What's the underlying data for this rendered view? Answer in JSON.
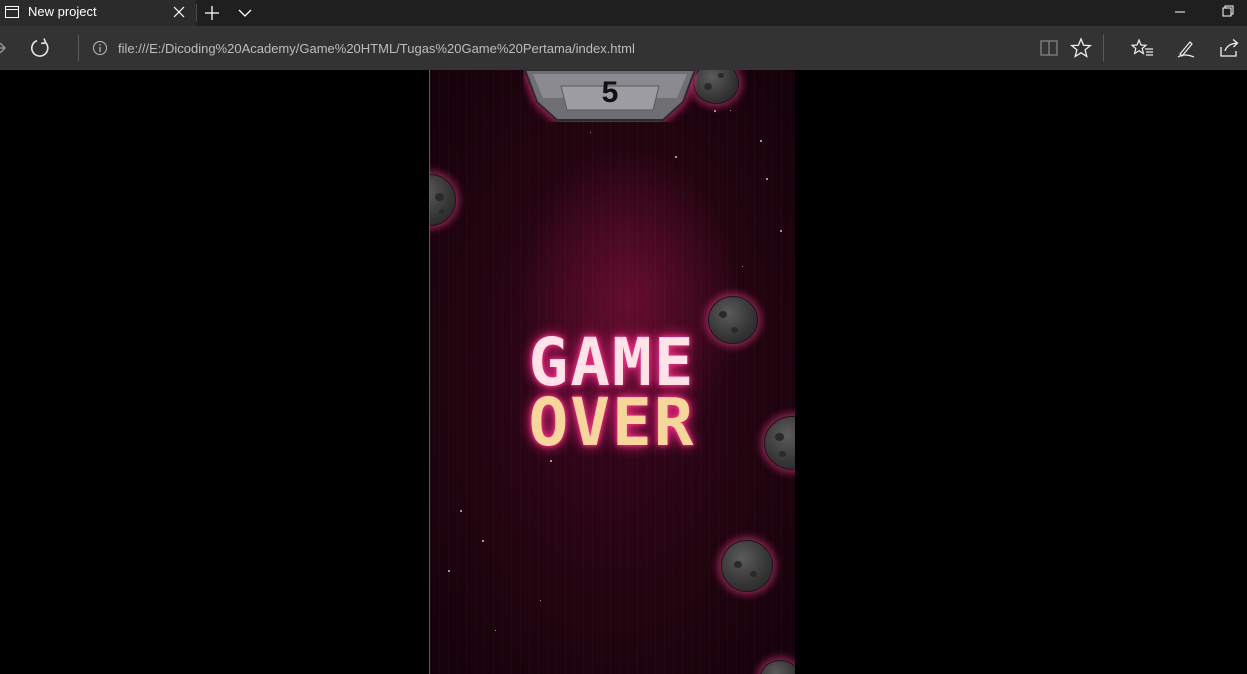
{
  "browser": {
    "tab": {
      "title": "New project",
      "favicon_icon": "window-icon",
      "close_icon": "close-icon"
    },
    "toolbar_icons": {
      "new_tab": "plus-icon",
      "tab_list": "chevron-down-icon",
      "minimize": "minimize-icon",
      "restore": "restore-icon",
      "forward": "forward-icon",
      "refresh": "refresh-icon",
      "site_info": "info-icon",
      "reading_view": "book-icon",
      "favorite": "star-icon",
      "hub": "favorites-list-icon",
      "notes": "pen-icon",
      "share": "share-icon"
    },
    "address": "file:///E:/Dicoding%20Academy/Game%20HTML/Tugas%20Game%20Pertama/index.html"
  },
  "game": {
    "score": "5",
    "game_over_line1": "GAME",
    "game_over_line2": "OVER"
  },
  "colors": {
    "tabstrip_bg": "#1f1f1f",
    "navbar_bg": "#333333",
    "game_bg": "#22040f",
    "glow": "#ff2d8a",
    "gameover_top": "#fde4e6",
    "gameover_bottom": "#f5d79a"
  }
}
